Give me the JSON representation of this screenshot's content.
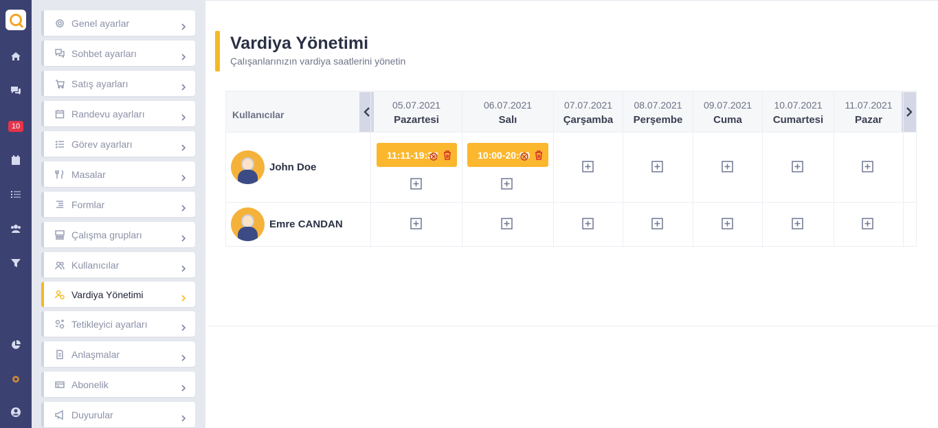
{
  "rail": {
    "badge": "10",
    "icons": [
      "home-icon",
      "chat-icon",
      "calendar-icon",
      "checklist-icon",
      "users-icon",
      "filter-icon",
      "pie-chart-icon",
      "gear-icon",
      "user-circle-icon"
    ]
  },
  "menu": {
    "items": [
      {
        "label": "Genel ayarlar",
        "icon": "gear-icon"
      },
      {
        "label": "Sohbet ayarları",
        "icon": "chat-icon"
      },
      {
        "label": "Satış ayarları",
        "icon": "cart-icon"
      },
      {
        "label": "Randevu ayarları",
        "icon": "calendar-icon"
      },
      {
        "label": "Görev ayarları",
        "icon": "checklist-icon"
      },
      {
        "label": "Masalar",
        "icon": "cutlery-icon"
      },
      {
        "label": "Formlar",
        "icon": "form-icon"
      },
      {
        "label": "Çalışma grupları",
        "icon": "group-icon"
      },
      {
        "label": "Kullanıcılar",
        "icon": "users-icon"
      },
      {
        "label": "Vardiya Yönetimi",
        "icon": "shift-user-icon",
        "active": true
      },
      {
        "label": "Tetikleyici ayarları",
        "icon": "trigger-icon"
      },
      {
        "label": "Anlaşmalar",
        "icon": "document-icon"
      },
      {
        "label": "Abonelik",
        "icon": "card-icon"
      },
      {
        "label": "Duyurular",
        "icon": "megaphone-icon"
      }
    ]
  },
  "page": {
    "title": "Vardiya Yönetimi",
    "subtitle": "Çalışanlarınızın vardiya saatlerini yönetin"
  },
  "table": {
    "users_header": "Kullanıcılar",
    "days": [
      {
        "date": "05.07.2021",
        "day": "Pazartesi"
      },
      {
        "date": "06.07.2021",
        "day": "Salı"
      },
      {
        "date": "07.07.2021",
        "day": "Çarşamba"
      },
      {
        "date": "08.07.2021",
        "day": "Perşembe"
      },
      {
        "date": "09.07.2021",
        "day": "Cuma"
      },
      {
        "date": "10.07.2021",
        "day": "Cumartesi"
      },
      {
        "date": "11.07.2021",
        "day": "Pazar"
      }
    ],
    "users": [
      {
        "name": "John Doe",
        "shifts": [
          "11:11-19:38",
          "10:00-20:00"
        ]
      },
      {
        "name": "Emre CANDAN",
        "shifts": []
      }
    ]
  },
  "colors": {
    "accent": "#f5b924",
    "rail": "#3b4170",
    "badge": "#e5344b"
  }
}
